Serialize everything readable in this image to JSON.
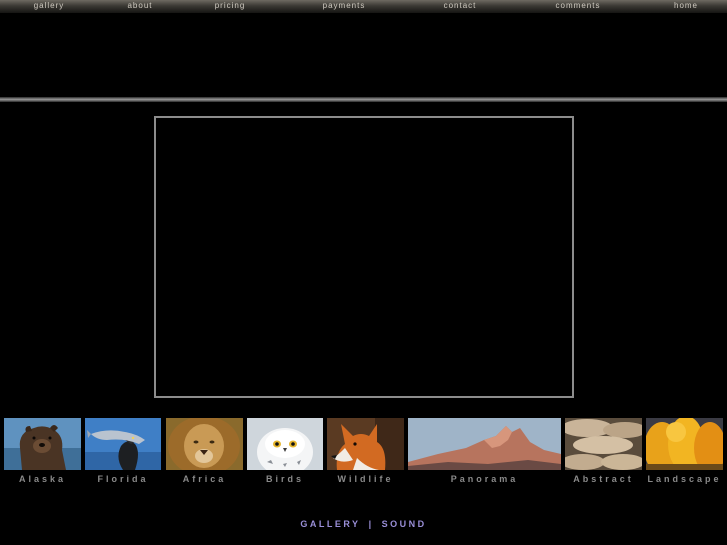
{
  "top_nav": {
    "items": [
      {
        "label": "gallery"
      },
      {
        "label": "about"
      },
      {
        "label": "pricing"
      },
      {
        "label": "payments"
      },
      {
        "label": "contact"
      },
      {
        "label": "comments"
      },
      {
        "label": "home"
      }
    ]
  },
  "thumbnails": [
    {
      "label": "Alaska",
      "depicts": "brown bear"
    },
    {
      "label": "Florida",
      "depicts": "bird with fish"
    },
    {
      "label": "Africa",
      "depicts": "lion"
    },
    {
      "label": "Birds",
      "depicts": "snowy owl"
    },
    {
      "label": "Wildlife",
      "depicts": "red fox"
    },
    {
      "label": "Panorama",
      "depicts": "mountain peaks"
    },
    {
      "label": "Abstract",
      "depicts": "smooth stones"
    },
    {
      "label": "Landscape",
      "depicts": "golden autumn trees"
    }
  ],
  "bottom_nav": {
    "gallery_label": "GALLERY",
    "separator": "|",
    "sound_label": "SOUND"
  },
  "colors": {
    "background": "#000000",
    "nav_text": "#cfcac0",
    "thumb_label": "#8a8a8a",
    "bottom_link": "#9a8fd8",
    "viewer_border": "#8c8c8c"
  }
}
